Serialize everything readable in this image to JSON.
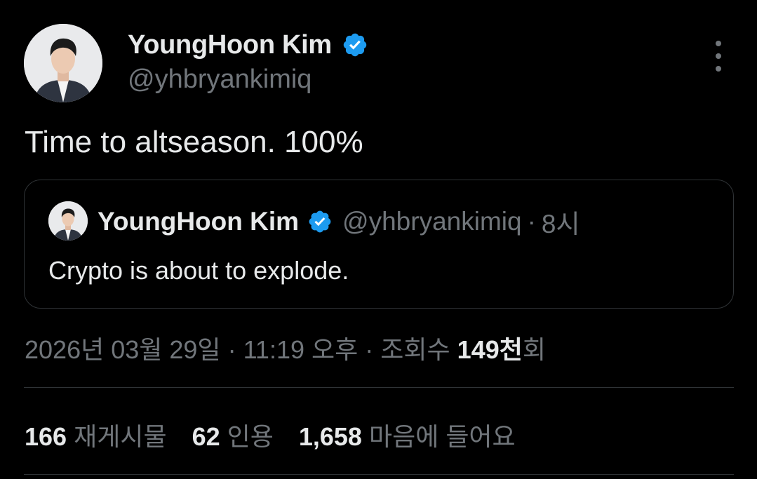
{
  "tweet": {
    "author": {
      "name": "YoungHoon Kim",
      "handle": "@yhbryankimiq",
      "verified": true
    },
    "text": "Time to altseason. 100%",
    "quoted": {
      "author_name": "YoungHoon Kim",
      "handle": "@yhbryankimiq",
      "separator": "·",
      "time_ago": "8시",
      "text": "Crypto is about to explode."
    },
    "meta": {
      "date": "2026년 03월 29일",
      "sep1": "·",
      "time": "11:19 오후",
      "sep2": "·",
      "views_label": "조회수",
      "views_number": "149천",
      "views_suffix": "회"
    },
    "stats": {
      "reposts_count": "166",
      "reposts_label": "재게시물",
      "quotes_count": "62",
      "quotes_label": "인용",
      "likes_count": "1,658",
      "likes_label": "마음에 들어요"
    }
  },
  "colors": {
    "background": "#000000",
    "text_primary": "#e7e9ea",
    "text_secondary": "#71767b",
    "border": "#2f3336",
    "verified_badge": "#1d9bf0"
  },
  "icons": {
    "verified": "verified-badge-icon",
    "more": "more-options-icon"
  }
}
